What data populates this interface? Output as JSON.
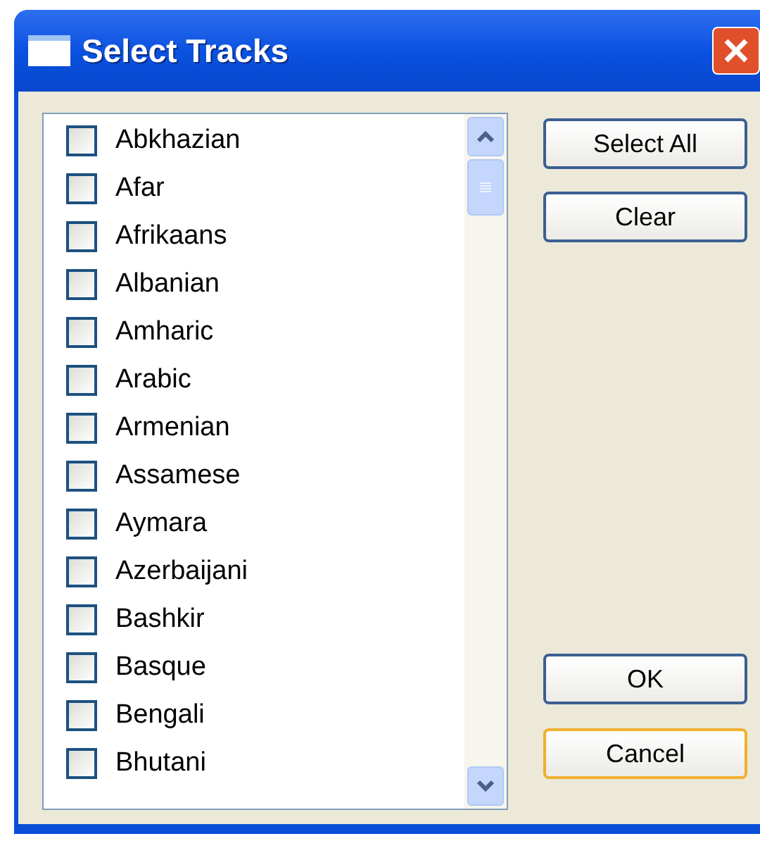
{
  "window": {
    "title": "Select Tracks"
  },
  "tracks": [
    {
      "label": "Abkhazian",
      "checked": false
    },
    {
      "label": "Afar",
      "checked": false
    },
    {
      "label": "Afrikaans",
      "checked": false
    },
    {
      "label": "Albanian",
      "checked": false
    },
    {
      "label": "Amharic",
      "checked": false
    },
    {
      "label": "Arabic",
      "checked": false
    },
    {
      "label": "Armenian",
      "checked": false
    },
    {
      "label": "Assamese",
      "checked": false
    },
    {
      "label": "Aymara",
      "checked": false
    },
    {
      "label": "Azerbaijani",
      "checked": false
    },
    {
      "label": "Bashkir",
      "checked": false
    },
    {
      "label": "Basque",
      "checked": false
    },
    {
      "label": "Bengali",
      "checked": false
    },
    {
      "label": "Bhutani",
      "checked": false
    }
  ],
  "top_buttons": [
    "Select All",
    "Clear"
  ],
  "bottom_buttons": [
    {
      "label": "OK",
      "focused": false
    },
    {
      "label": "Cancel",
      "focused": true
    }
  ]
}
